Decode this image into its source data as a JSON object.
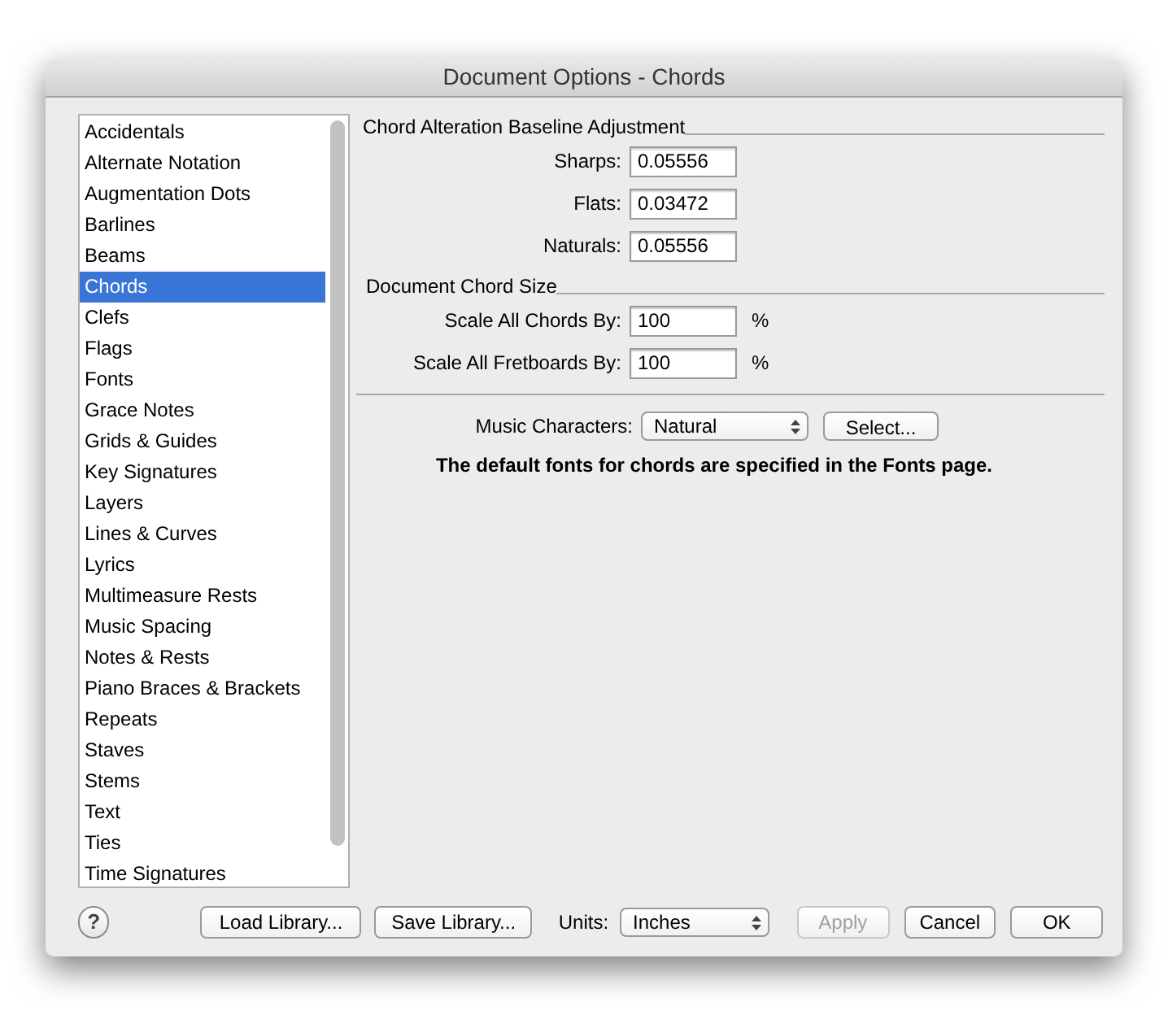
{
  "window": {
    "title": "Document Options - Chords"
  },
  "sidebar": {
    "items": [
      {
        "label": "Accidentals",
        "selected": false
      },
      {
        "label": "Alternate Notation",
        "selected": false
      },
      {
        "label": "Augmentation Dots",
        "selected": false
      },
      {
        "label": "Barlines",
        "selected": false
      },
      {
        "label": "Beams",
        "selected": false
      },
      {
        "label": "Chords",
        "selected": true
      },
      {
        "label": "Clefs",
        "selected": false
      },
      {
        "label": "Flags",
        "selected": false
      },
      {
        "label": "Fonts",
        "selected": false
      },
      {
        "label": "Grace Notes",
        "selected": false
      },
      {
        "label": "Grids & Guides",
        "selected": false
      },
      {
        "label": "Key Signatures",
        "selected": false
      },
      {
        "label": "Layers",
        "selected": false
      },
      {
        "label": "Lines & Curves",
        "selected": false
      },
      {
        "label": "Lyrics",
        "selected": false
      },
      {
        "label": "Multimeasure Rests",
        "selected": false
      },
      {
        "label": "Music Spacing",
        "selected": false
      },
      {
        "label": "Notes & Rests",
        "selected": false
      },
      {
        "label": "Piano Braces & Brackets",
        "selected": false
      },
      {
        "label": "Repeats",
        "selected": false
      },
      {
        "label": "Staves",
        "selected": false
      },
      {
        "label": "Stems",
        "selected": false
      },
      {
        "label": "Text",
        "selected": false
      },
      {
        "label": "Ties",
        "selected": false
      },
      {
        "label": "Time Signatures",
        "selected": false
      }
    ]
  },
  "sections": [
    {
      "title": "Chord Alteration Baseline Adjustment",
      "fields": [
        {
          "label": "Sharps:",
          "value": "0.05556"
        },
        {
          "label": "Flats:",
          "value": "0.03472"
        },
        {
          "label": "Naturals:",
          "value": "0.05556"
        }
      ]
    },
    {
      "title": "Document Chord Size",
      "fields": [
        {
          "label": "Scale All Chords By:",
          "value": "100",
          "unit": "%"
        },
        {
          "label": "Scale All Fretboards By:",
          "value": "100",
          "unit": "%"
        }
      ]
    }
  ],
  "music_characters": {
    "label": "Music Characters:",
    "value": "Natural",
    "button": "Select..."
  },
  "note": "The default fonts for chords are specified in the Fonts page.",
  "footer": {
    "help": "?",
    "buttons_left": [
      "Load Library...",
      "Save Library..."
    ],
    "units_label": "Units:",
    "units_value": "Inches",
    "buttons_right": [
      {
        "label": "Apply",
        "disabled": true
      },
      {
        "label": "Cancel",
        "disabled": false
      },
      {
        "label": "OK",
        "disabled": false
      }
    ]
  }
}
